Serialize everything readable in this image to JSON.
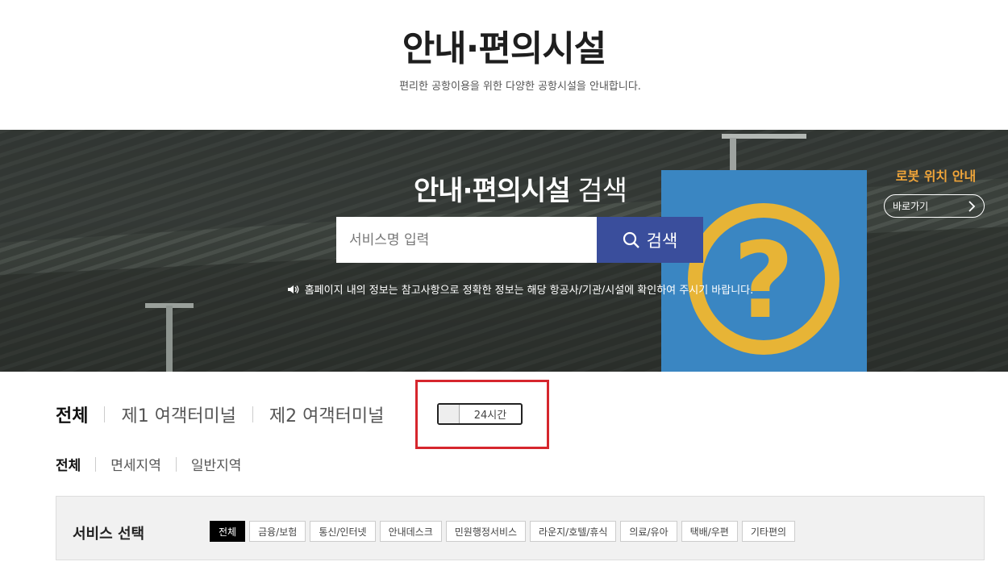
{
  "header": {
    "title": "안내·편의시설",
    "subtitle": "편리한 공항이용을 위한 다양한 공항시설을 안내합니다."
  },
  "hero": {
    "title_bold": "안내·편의시설",
    "title_light": " 검색",
    "search_placeholder": "서비스명 입력",
    "search_button": "검색",
    "notice": "홈페이지 내의 정보는 참고사항으로 정확한 정보는 해당 항공사/기관/시설에 확인하여 주시기 바랍니다.",
    "robot_title": "로봇 위치 안내",
    "robot_button": "바로가기"
  },
  "terminal_tabs": [
    {
      "label": "전체",
      "active": true
    },
    {
      "label": "제1 여객터미널",
      "active": false
    },
    {
      "label": "제2 여객터미널",
      "active": false
    }
  ],
  "toggle": {
    "label": "24시간"
  },
  "area_tabs": [
    {
      "label": "전체",
      "active": true
    },
    {
      "label": "면세지역",
      "active": false
    },
    {
      "label": "일반지역",
      "active": false
    }
  ],
  "service": {
    "label": "서비스 선택",
    "chips": [
      "전체",
      "금융/보험",
      "통신/인터넷",
      "안내데스크",
      "민원행정서비스",
      "라운지/호텔/휴식",
      "의료/유아",
      "택배/우편",
      "기타편의"
    ]
  },
  "colors": {
    "search_button": "#3a4e9c",
    "robot_title": "#f0a53a",
    "highlight": "#d6262d"
  }
}
